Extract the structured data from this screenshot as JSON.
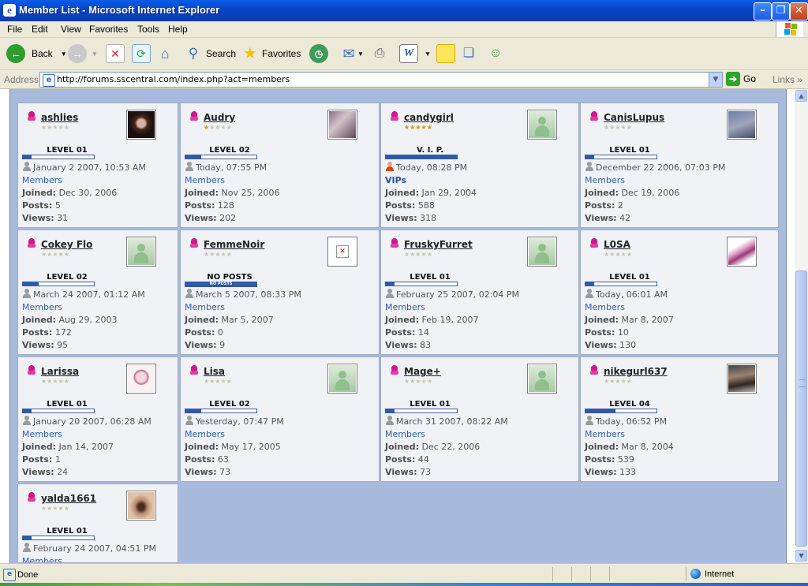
{
  "window": {
    "title": "Member List - Microsoft Internet Explorer",
    "icon": "ie-icon",
    "controls": [
      "minimize",
      "restore",
      "close"
    ]
  },
  "menu": [
    "File",
    "Edit",
    "View",
    "Favorites",
    "Tools",
    "Help"
  ],
  "toolbar": {
    "back": "Back",
    "search": "Search",
    "favorites": "Favorites"
  },
  "address": {
    "label": "Address",
    "url": "http://forums.sscentral.com/index.php?act=members",
    "go": "Go",
    "links": "Links"
  },
  "labels": {
    "joined": "Joined:",
    "posts": "Posts:",
    "views": "Views:"
  },
  "members": [
    {
      "name": "ashlies",
      "stars": 0,
      "avatar": "photo1",
      "level": "LEVEL 01",
      "bar": 0.12,
      "last": "January 2 2007, 10:53 AM",
      "group": "Members",
      "joined": "Dec 30, 2006",
      "posts": "5",
      "views": "31"
    },
    {
      "name": "Audry",
      "stars": 1,
      "avatar": "photo2",
      "level": "LEVEL 02",
      "bar": 0.22,
      "last": "Today, 07:55 PM",
      "group": "Members",
      "joined": "Nov 25, 2006",
      "posts": "128",
      "views": "202"
    },
    {
      "name": "candygirl",
      "stars": 5,
      "avatar": "default",
      "level": "V. I. P.",
      "bar": 1,
      "last": "Today, 08:28 PM",
      "group": "VIPs",
      "joined": "Jan 29, 2004",
      "posts": "588",
      "views": "318",
      "vip": true
    },
    {
      "name": "CanisLupus",
      "stars": 0,
      "avatar": "photo3",
      "level": "LEVEL 01",
      "bar": 0.12,
      "last": "December 22 2006, 07:03 PM",
      "group": "Members",
      "joined": "Dec 19, 2006",
      "posts": "2",
      "views": "42"
    },
    {
      "name": "Cokey Flo",
      "stars": 0,
      "avatar": "default",
      "level": "LEVEL 02",
      "bar": 0.22,
      "last": "March 24 2007, 01:12 AM",
      "group": "Members",
      "joined": "Aug 29, 2003",
      "posts": "172",
      "views": "95"
    },
    {
      "name": "FemmeNoir",
      "stars": 0,
      "avatar": "broken",
      "level": "NO POSTS",
      "bar": 0,
      "bar_text": "NO POSTS",
      "last": "March 5 2007, 08:33 PM",
      "group": "Members",
      "joined": "Mar 5, 2007",
      "posts": "0",
      "views": "9"
    },
    {
      "name": "FruskyFurret",
      "stars": 0,
      "avatar": "default",
      "level": "LEVEL 01",
      "bar": 0.12,
      "last": "February 25 2007, 02:04 PM",
      "group": "Members",
      "joined": "Feb 19, 2007",
      "posts": "14",
      "views": "83"
    },
    {
      "name": "L0SA",
      "stars": 0,
      "avatar": "photo4",
      "level": "LEVEL 01",
      "bar": 0.12,
      "last": "Today, 06:01 AM",
      "group": "Members",
      "joined": "Mar 8, 2007",
      "posts": "10",
      "views": "130"
    },
    {
      "name": "Larissa",
      "stars": 0,
      "avatar": "photo5",
      "level": "LEVEL 01",
      "bar": 0.12,
      "last": "January 20 2007, 06:28 AM",
      "group": "Members",
      "joined": "Jan 14, 2007",
      "posts": "1",
      "views": "24"
    },
    {
      "name": "Lisa",
      "stars": 0,
      "avatar": "default",
      "level": "LEVEL 02",
      "bar": 0.22,
      "last": "Yesterday, 07:47 PM",
      "group": "Members",
      "joined": "May 17, 2005",
      "posts": "63",
      "views": "73"
    },
    {
      "name": "Mage+",
      "stars": 0,
      "avatar": "default",
      "level": "LEVEL 01",
      "bar": 0.12,
      "last": "March 31 2007, 08:22 AM",
      "group": "Members",
      "joined": "Dec 22, 2006",
      "posts": "44",
      "views": "73"
    },
    {
      "name": "nikegurl637",
      "stars": 0,
      "avatar": "photo6",
      "level": "LEVEL 04",
      "bar": 0.42,
      "last": "Today, 06:52 PM",
      "group": "Members",
      "joined": "Mar 8, 2004",
      "posts": "539",
      "views": "133"
    },
    {
      "name": "yalda1661",
      "stars": 0,
      "avatar": "photo7",
      "level": "LEVEL 01",
      "bar": 0.12,
      "last": "February 24 2007, 04:51 PM",
      "group": "Members",
      "joined": "",
      "posts": "",
      "views": ""
    }
  ],
  "status": {
    "text": "Done",
    "zone": "Internet"
  }
}
